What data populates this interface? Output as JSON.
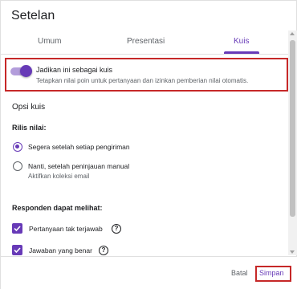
{
  "dialog": {
    "title": "Setelan"
  },
  "tabs": [
    {
      "label": "Umum",
      "active": false
    },
    {
      "label": "Presentasi",
      "active": false
    },
    {
      "label": "Kuis",
      "active": true
    }
  ],
  "quiz_toggle": {
    "label": "Jadikan ini sebagai kuis",
    "description": "Tetapkan nilai poin untuk pertanyaan dan izinkan pemberian nilai otomatis.",
    "enabled": true
  },
  "quiz_options": {
    "title": "Opsi kuis",
    "release_label": "Rilis nilai:",
    "release_options": [
      {
        "label": "Segera setelah setiap pengiriman",
        "checked": true
      },
      {
        "label": "Nanti, setelah peninjauan manual",
        "sublabel": "Aktifkan koleksi email",
        "checked": false
      }
    ],
    "respondents_label": "Responden dapat melihat:",
    "respondent_options": [
      {
        "label": "Pertanyaan tak terjawab",
        "checked": true
      },
      {
        "label": "Jawaban yang benar",
        "checked": true
      }
    ]
  },
  "footer": {
    "cancel_label": "Batal",
    "save_label": "Simpan"
  },
  "colors": {
    "accent": "#673ab7",
    "highlight": "#c62828"
  },
  "icons": {
    "help": "?"
  }
}
